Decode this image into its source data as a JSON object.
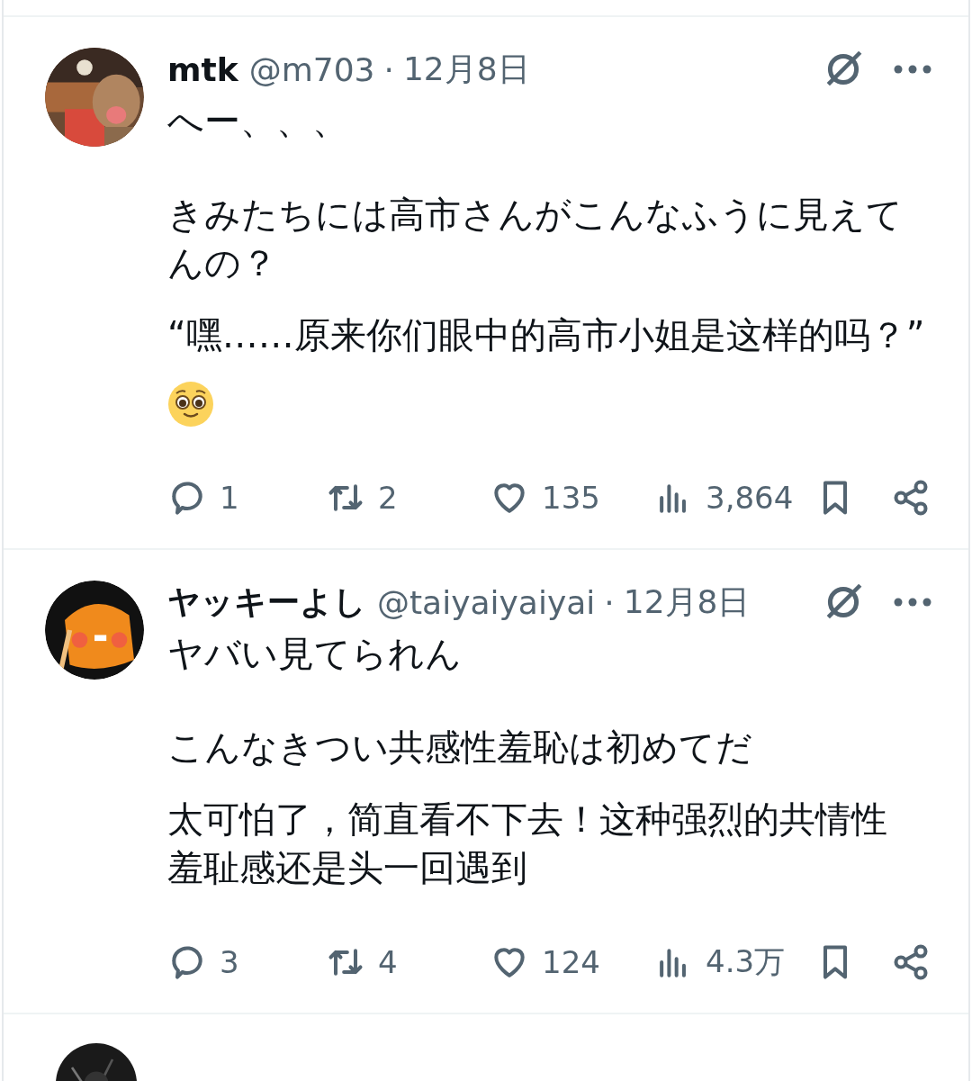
{
  "tweets": [
    {
      "name": "mtk",
      "handle": "@m703",
      "separator": "·",
      "date": "12月8日",
      "original": [
        "へー、、、",
        "きみたちには高市さんがこんなふうに見えてんの？"
      ],
      "translation": "“嘿……原来你们眼中的高市小姐是这样的吗？”",
      "emoji": true,
      "stats": [
        {
          "kind": "reply",
          "count": "1"
        },
        {
          "kind": "repost",
          "count": "2"
        },
        {
          "kind": "like",
          "count": "135"
        },
        {
          "kind": "views",
          "count": "3,864"
        }
      ]
    },
    {
      "name": "ヤッキーよし",
      "handle": "@taiyaiyaiyai",
      "separator": "·",
      "date": "12月8日",
      "original": [
        "ヤバい見てられん",
        "こんなきつい共感性羞恥は初めてだ"
      ],
      "translation": "太可怕了，简直看不下去！这种强烈的共情性羞耻感还是头一回遇到",
      "stats": [
        {
          "kind": "reply",
          "count": "3"
        },
        {
          "kind": "repost",
          "count": "4"
        },
        {
          "kind": "like",
          "count": "124"
        },
        {
          "kind": "views",
          "count": "4.3万"
        }
      ]
    }
  ]
}
